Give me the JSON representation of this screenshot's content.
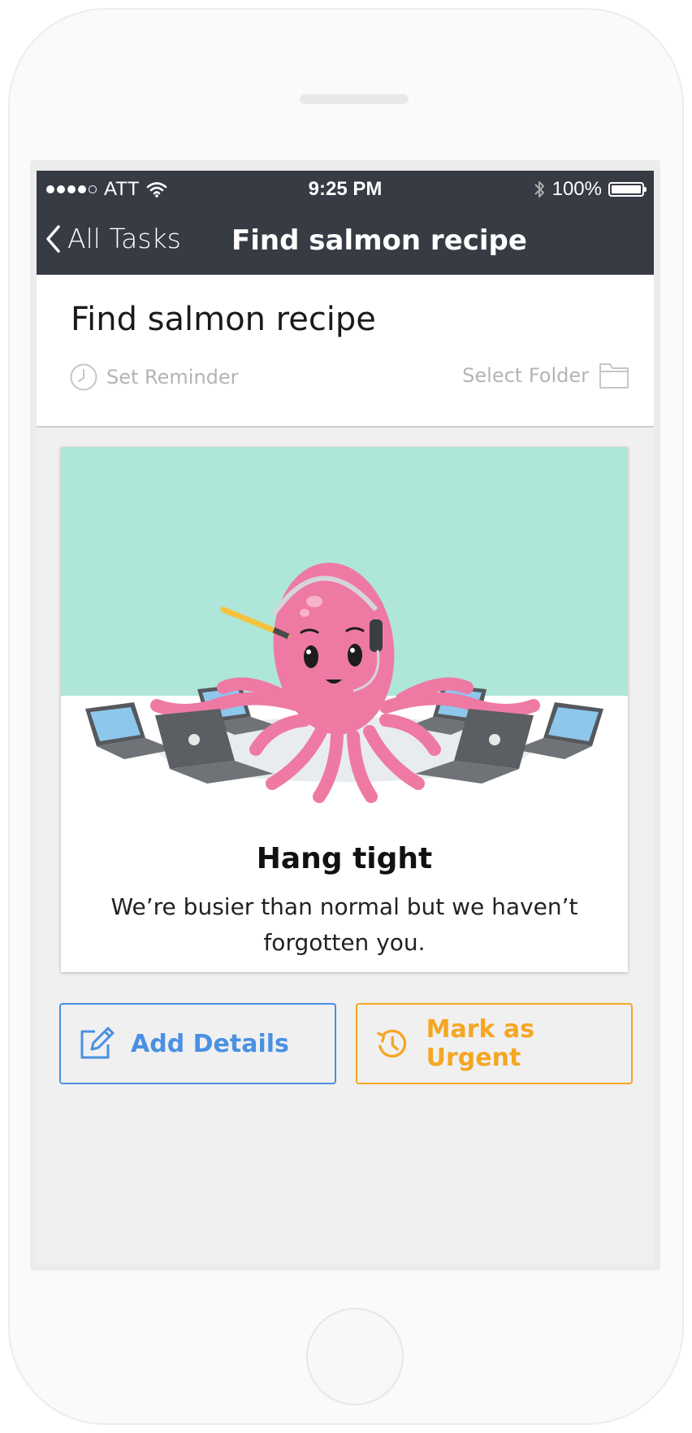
{
  "status_bar": {
    "carrier": "ATT",
    "time": "9:25 PM",
    "battery": "100%"
  },
  "nav": {
    "back_label": "All Tasks",
    "title": "Find salmon recipe"
  },
  "task": {
    "title": "Find salmon recipe",
    "reminder_label": "Set Reminder",
    "folder_label": "Select Folder"
  },
  "message": {
    "title": "Hang tight",
    "body": "We’re busier than normal but we haven’t forgotten you."
  },
  "actions": {
    "add_details": "Add Details",
    "mark_urgent": "Mark as Urgent"
  },
  "colors": {
    "nav_bg": "#363b44",
    "accent_blue": "#4a90e2",
    "accent_orange": "#f5a623",
    "octopus": "#ee7aa4",
    "illustration_bg": "#aee6da"
  }
}
